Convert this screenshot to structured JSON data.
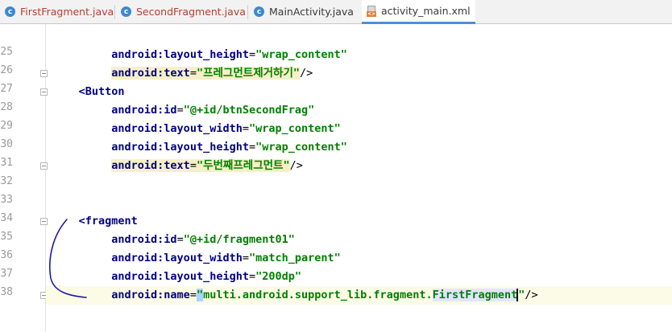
{
  "tabs": [
    {
      "label": "FirstFragment.java",
      "icon": "java-class-icon",
      "icon_glyph": "c",
      "style": "modified"
    },
    {
      "label": "SecondFragment.java",
      "icon": "java-class-icon",
      "icon_glyph": "c",
      "style": "modified"
    },
    {
      "label": "MainActivity.java",
      "icon": "java-class-icon",
      "icon_glyph": "c",
      "style": "normal"
    },
    {
      "label": "activity_main.xml",
      "icon": "xml-file-icon",
      "icon_glyph": "<>",
      "style": "active"
    }
  ],
  "line_numbers": [
    "25",
    "26",
    "27",
    "28",
    "29",
    "30",
    "31",
    "32",
    "33",
    "34",
    "35",
    "36",
    "37",
    "38"
  ],
  "code": {
    "l25": {
      "attr": "android:layout_height",
      "eq": "=",
      "val": "\"wrap_content\""
    },
    "l26": {
      "attr": "android:text",
      "eq": "=",
      "val": "\"프레그먼트제거하기\"",
      "end": "/>"
    },
    "l27": {
      "tag": "<Button"
    },
    "l28": {
      "attr": "android:id",
      "eq": "=",
      "val": "\"@+id/btnSecondFrag\""
    },
    "l29": {
      "attr": "android:layout_width",
      "eq": "=",
      "val": "\"wrap_content\""
    },
    "l30": {
      "attr": "android:layout_height",
      "eq": "=",
      "val": "\"wrap_content\""
    },
    "l31": {
      "attr": "android:text",
      "eq": "=",
      "val": "\"두번째프레그먼트\"",
      "end": "/>"
    },
    "l34": {
      "tag": "<fragment"
    },
    "l35": {
      "attr": "android:id",
      "eq": "=",
      "val": "\"@+id/fragment01\""
    },
    "l36": {
      "attr": "android:layout_width",
      "eq": "=",
      "val": "\"match_parent\""
    },
    "l37": {
      "attr": "android:layout_height",
      "eq": "=",
      "val": "\"200dp\""
    },
    "l38": {
      "attr": "android:name",
      "eq": "=",
      "q1": "\"",
      "val_a": "multi.android.support_lib.fragment.",
      "val_b": "FirstFragment",
      "q2": "\"",
      "end": "/>"
    }
  },
  "colors": {
    "keyword": "#000080",
    "string": "#008000",
    "active_tab_underline": "#4c8fd6",
    "annotation": "#1a1aa8"
  }
}
